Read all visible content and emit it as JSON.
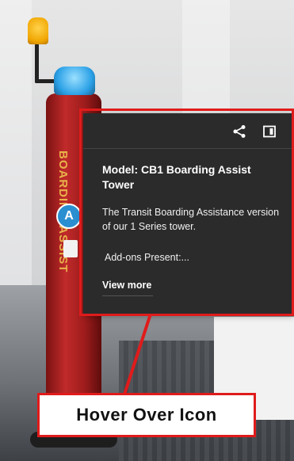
{
  "tower": {
    "label": "BOARDING ASSIST",
    "badge": "A"
  },
  "tooltip": {
    "title": "Model: CB1 Boarding Assist Tower",
    "description": "The Transit Boarding Assistance version of our 1 Series tower.",
    "addons": "Add-ons Present:...",
    "view_more": "View more",
    "icons": [
      "share-icon",
      "side-panel-icon"
    ]
  },
  "caption": {
    "text": "Hover Over Icon"
  },
  "colors": {
    "highlight": "#e01b1b",
    "tooltip_bg": "#2b2b2b",
    "tower_red": "#b02020",
    "badge_blue": "#2a8fd0"
  }
}
